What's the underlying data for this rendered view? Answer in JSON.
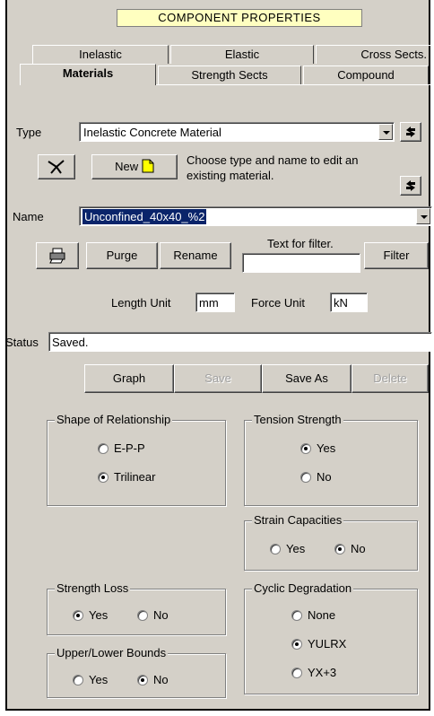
{
  "header": {
    "title": "COMPONENT PROPERTIES"
  },
  "tabs": {
    "row1": [
      "Inelastic",
      "Elastic",
      "Cross Sects."
    ],
    "row2": [
      "Materials",
      "Strength Sects",
      "Compound"
    ]
  },
  "type_row": {
    "label": "Type",
    "value": "Inelastic Concrete Material",
    "refresh_icon": "refresh-icon"
  },
  "toolbar1": {
    "tool_icon": "compass-icon",
    "new_label": "New",
    "new_icon": "new-document-icon",
    "hint": "Choose type and name to edit an existing material."
  },
  "name_row": {
    "label": "Name",
    "value": "Unconfined_40x40_%2"
  },
  "toolbar2": {
    "print_icon": "printer-icon",
    "purge_label": "Purge",
    "rename_label": "Rename",
    "filter_caption": "Text for filter.",
    "filter_value": "",
    "filter_label": "Filter"
  },
  "units": {
    "length_label": "Length Unit",
    "length_value": "mm",
    "force_label": "Force Unit",
    "force_value": "kN"
  },
  "status": {
    "label": "Status",
    "value": "Saved."
  },
  "actions": {
    "graph": "Graph",
    "save": "Save",
    "save_as": "Save As",
    "delete": "Delete"
  },
  "shape": {
    "legend": "Shape of Relationship",
    "opt1": "E-P-P",
    "opt2": "Trilinear",
    "selected": "Trilinear"
  },
  "tension": {
    "legend": "Tension Strength",
    "yes": "Yes",
    "no": "No",
    "selected": "Yes"
  },
  "strain": {
    "legend": "Strain Capacities",
    "yes": "Yes",
    "no": "No",
    "selected": "No"
  },
  "strength_loss": {
    "legend": "Strength Loss",
    "yes": "Yes",
    "no": "No",
    "selected": "Yes"
  },
  "cyclic": {
    "legend": "Cyclic Degradation",
    "opt1": "None",
    "opt2": "YULRX",
    "opt3": "YX+3",
    "selected": "YULRX"
  },
  "bounds": {
    "legend": "Upper/Lower Bounds",
    "yes": "Yes",
    "no": "No",
    "selected": "No"
  },
  "colors": {
    "face": "#d4d0c8",
    "title_bg": "#ffffc0",
    "selection": "#0a246a"
  }
}
